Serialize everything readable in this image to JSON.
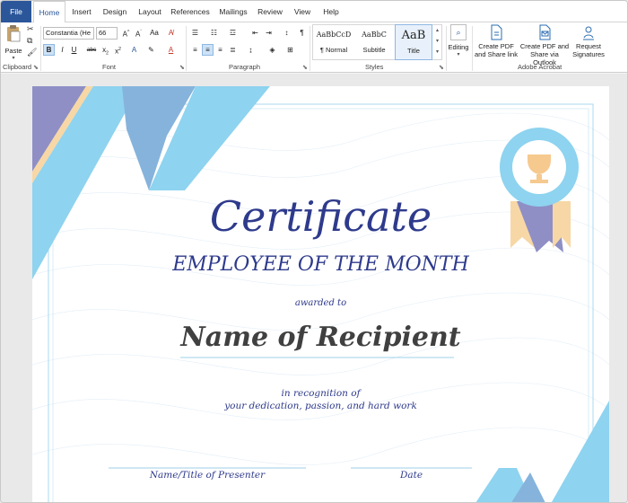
{
  "tabs": {
    "file": "File",
    "home": "Home",
    "insert": "Insert",
    "design": "Design",
    "layout": "Layout",
    "references": "References",
    "mailings": "Mailings",
    "review": "Review",
    "view": "View",
    "help": "Help"
  },
  "ribbon": {
    "clipboard": {
      "paste_label": "Paste",
      "group_label": "Clipboard"
    },
    "font": {
      "font_name": "Constantia (He",
      "font_size": "66",
      "group_label": "Font"
    },
    "paragraph": {
      "group_label": "Paragraph"
    },
    "styles": {
      "group_label": "Styles",
      "items": [
        {
          "sample": "AaBbCcD",
          "name": "¶ Normal"
        },
        {
          "sample": "AaBbC",
          "name": "Subtitle"
        },
        {
          "sample": "AaB",
          "name": "Title"
        }
      ]
    },
    "editing": {
      "label": "Editing"
    },
    "acrobat": {
      "group_label": "Adobe Acrobat",
      "create_pdf_share_link": "Create PDF and Share link",
      "create_pdf_outlook": "Create PDF and Share via Outlook",
      "request_signatures": "Request Signatures"
    }
  },
  "certificate": {
    "title": "Certificate",
    "subtitle": "EMPLOYEE OF THE MONTH",
    "awarded_to": "awarded to",
    "recipient": "Name of Recipient",
    "recognition_line1": "in recognition of",
    "recognition_line2": "your dedication, passion, and hard work",
    "presenter_label": "Name/Title of Presenter",
    "date_label": "Date"
  },
  "colors": {
    "word_blue": "#2b579a",
    "cert_text": "#2e3a8c",
    "ribbon_light_blue": "#8ed3ef",
    "ribbon_mid_blue": "#86b3dc",
    "ribbon_purple": "#8f8fc6",
    "ribbon_peach": "#f7d7a5",
    "medal_gold": "#f6c98f"
  }
}
